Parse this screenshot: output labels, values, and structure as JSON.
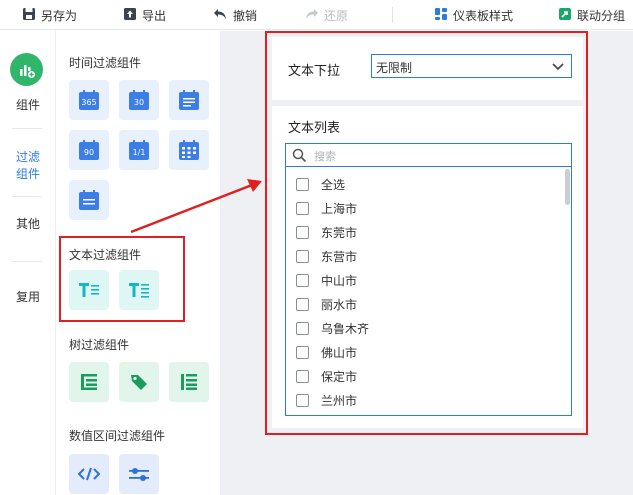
{
  "toolbar": {
    "save_as": "另存为",
    "export": "导出",
    "undo": "撤销",
    "redo": "还原",
    "dashboard_style": "仪表板样式",
    "linkage_group": "联动分组"
  },
  "rail": {
    "components": "组件",
    "filter_components_line1": "过滤",
    "filter_components_line2": "组件",
    "other": "其他",
    "reuse": "复用"
  },
  "panel": {
    "time_filter_title": "时间过滤组件",
    "time_tiles": [
      "365",
      "30",
      "",
      "90",
      "1/1",
      ""
    ],
    "text_filter_title": "文本过滤组件",
    "tree_filter_title": "树过滤组件",
    "range_filter_title": "数值区间过滤组件"
  },
  "canvas": {
    "dropdown_label": "文本下拉",
    "dropdown_value": "无限制",
    "list_label": "文本列表",
    "search_placeholder": "搜索",
    "items": [
      "全选",
      "上海市",
      "东莞市",
      "东营市",
      "中山市",
      "丽水市",
      "乌鲁木齐",
      "佛山市",
      "保定市",
      "兰州市"
    ]
  },
  "colors": {
    "accent": "#2c7be5",
    "highlight": "#e02020",
    "brand_green": "#2fb66b"
  }
}
